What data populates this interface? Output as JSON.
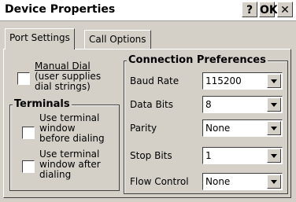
{
  "window": {
    "title": "Device Properties",
    "help_label": "?",
    "ok_label": "OK",
    "close_label": "✕"
  },
  "tabs": [
    {
      "label": "Port Settings"
    },
    {
      "label": "Call Options"
    }
  ],
  "manual_dial": {
    "lines": [
      "Manual Dial",
      "(user supplies",
      "dial strings)"
    ],
    "checked": false
  },
  "terminals": {
    "legend": "Terminals",
    "options": [
      {
        "lines": [
          "Use terminal",
          "window",
          "before dialing"
        ],
        "checked": false
      },
      {
        "lines": [
          "Use terminal",
          "window after",
          "dialing"
        ],
        "checked": false
      }
    ]
  },
  "connection": {
    "legend": "Connection Preferences",
    "fields": [
      {
        "label": "Baud Rate",
        "value": "115200"
      },
      {
        "label": "Data Bits",
        "value": "8"
      },
      {
        "label": "Parity",
        "value": "None"
      },
      {
        "label": "Stop Bits",
        "value": "1"
      },
      {
        "label": "Flow Control",
        "value": "None"
      }
    ]
  }
}
